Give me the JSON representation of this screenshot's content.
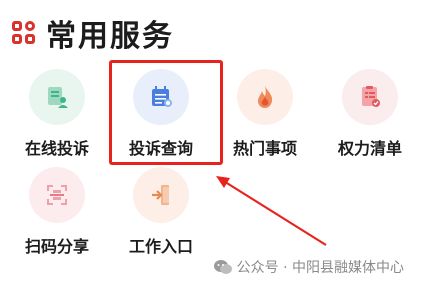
{
  "header": {
    "title": "常用服务",
    "icon": "grid-icon",
    "accent": "#d9322c"
  },
  "services": [
    {
      "label": "在线投诉",
      "icon": "complaint-form-icon"
    },
    {
      "label": "投诉查询",
      "icon": "query-calendar-icon"
    },
    {
      "label": "热门事项",
      "icon": "flame-icon"
    },
    {
      "label": "权力清单",
      "icon": "checklist-icon"
    },
    {
      "label": "扫码分享",
      "icon": "scan-code-icon"
    },
    {
      "label": "工作入口",
      "icon": "entrance-door-icon"
    }
  ],
  "highlight_color": "#e8221c",
  "watermark": {
    "text": "公众号 · 中阳县融媒体中心",
    "icon": "wechat-icon"
  }
}
